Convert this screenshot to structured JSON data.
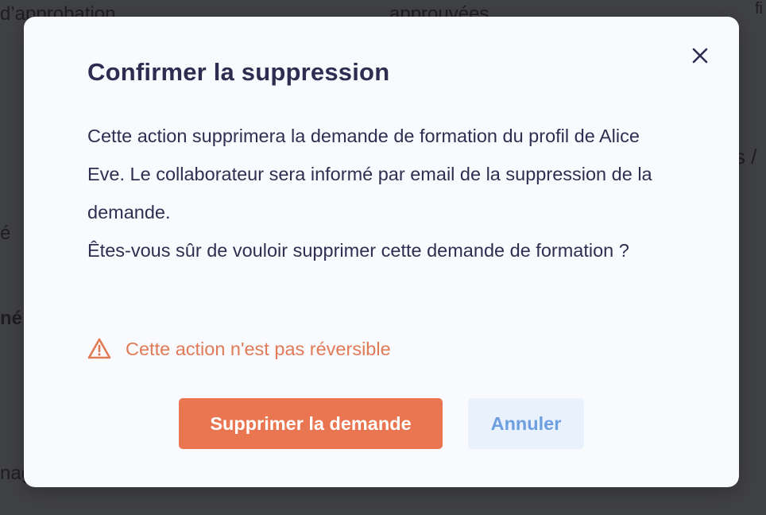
{
  "background": {
    "fragments": [
      "d’approbation",
      "approuvées",
      "fi",
      "s /",
      "é",
      "né",
      "nag"
    ]
  },
  "modal": {
    "title": "Confirmer la suppression",
    "close_icon": "close-icon",
    "body_paragraph_1": "Cette action supprimera la demande de formation du profil de Alice Eve. Le collaborateur sera informé par email de la suppression de la demande.",
    "body_paragraph_2": "Êtes-vous sûr de vouloir supprimer cette demande de formation ?",
    "warning_icon": "warning-triangle-icon",
    "warning_text": "Cette action n'est pas réversible",
    "delete_label": "Supprimer la demande",
    "cancel_label": "Annuler"
  },
  "colors": {
    "title": "#2d2d52",
    "warning": "#e07a57",
    "delete_button": "#ea7651",
    "cancel_button_bg": "#e8f1fc",
    "cancel_button_text": "#6d9fe0",
    "overlay": "#404143"
  }
}
